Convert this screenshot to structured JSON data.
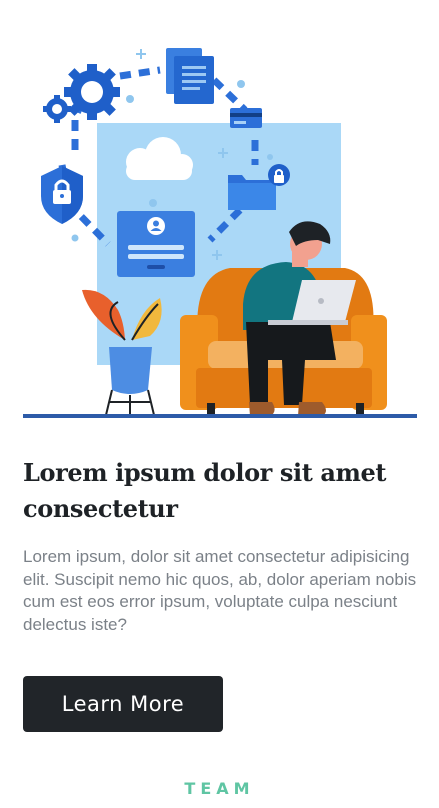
{
  "hero": {
    "illustration": "person-with-laptop-on-armchair-cloud-security-illustration",
    "icons": [
      "gear-icon",
      "document-icon",
      "credit-card-icon",
      "cloud-icon",
      "shield-lock-icon",
      "user-login-icon",
      "folder-lock-icon",
      "plant-icon",
      "armchair-icon",
      "laptop-icon"
    ]
  },
  "content": {
    "title": "Lorem ipsum dolor sit amet consectetur",
    "description": "Lorem ipsum, dolor sit amet consectetur adipisicing elit. Suscipit nemo hic quos, ab, dolor aperiam nobis cum est eos error ipsum, voluptate culpa nesciunt delectus iste?",
    "button_label": "Learn More"
  },
  "next_section": {
    "label": "TEAM"
  },
  "colors": {
    "heading": "#1e2226",
    "body_text": "#7b8188",
    "button_bg": "#212529",
    "accent": "#5fc5a3",
    "illustration_blue": "#2c6fd8",
    "armchair_orange": "#e27a12"
  }
}
